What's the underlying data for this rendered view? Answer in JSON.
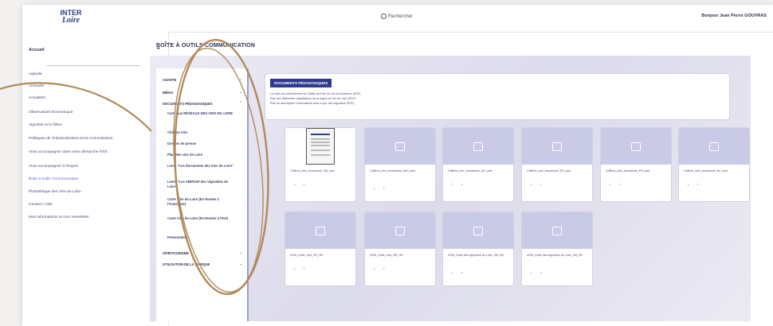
{
  "header": {
    "logo_line1": "INTER",
    "logo_line2": "Loire",
    "search_label": "Rechercher",
    "user_name": "Bonjour Jean Pierre GOUVRAS"
  },
  "sidebar": {
    "home_label": "Accueil",
    "items": [
      {
        "label": "Agenda",
        "active": false,
        "chevron": false
      },
      {
        "label": "Annuaire",
        "active": false,
        "chevron": false
      },
      {
        "label": "Actualités",
        "active": false,
        "chevron": false
      },
      {
        "label": "Observatoire Économique",
        "active": false,
        "chevron": true
      },
      {
        "label": "Vignoble et la filière",
        "active": false,
        "chevron": true
      },
      {
        "label": "Politiques de l'Interprofession et les Commissions",
        "active": false,
        "chevron": true
      },
      {
        "label": "Vous accompagner dans votre démarche RSE",
        "active": false,
        "chevron": true
      },
      {
        "label": "Vous accompagner à l'Export",
        "active": false,
        "chevron": true
      },
      {
        "label": "Boîte à outils Communication",
        "active": true,
        "chevron": false
      },
      {
        "label": "Photothèque des Vins de Loire",
        "active": false,
        "chevron": false
      },
      {
        "label": "Contact / Aide",
        "active": false,
        "chevron": false
      },
      {
        "label": "Mes informations et mon newsletter",
        "active": false,
        "chevron": false
      }
    ]
  },
  "main": {
    "title": "BOÎTE À OUTILS COMMUNICATION"
  },
  "tree": {
    "items": [
      {
        "label": "CHARTE",
        "chevron": "v"
      },
      {
        "label": "MÉDIA",
        "chevron": "v"
      },
      {
        "label": "DOCUMENTS PÉDAGOGIQUES",
        "chevron": "^"
      }
    ],
    "subitems": [
      "Carte aux RÉSEAUX DES VINS DE LOIRE",
      "Chiffres clés",
      "Dossier de presse",
      "Plan des vins de Loire",
      "Livret \"Les documents des Vins de Loire\"",
      "Livret \"Les SMPDSP des Vignobles de Loire\"",
      "Carte Vins de Loire (En Routes à l'Ouest/Est)",
      "Carte Vins de Loire (En Routes à l'Est)",
      "Présentations"
    ],
    "bottom_items": [
      {
        "label": "SPIRITOURISME",
        "chevron": "v"
      },
      {
        "label": "UTILISATION DE LA MARQUE",
        "chevron": "v"
      }
    ]
  },
  "info_box": {
    "title": "DOCUMENTS PÉDAGOGIQUES",
    "lines": [
      "La carte pré-sélectionnée au Chiffre de Plan de Vin de Bordeaux (PDF).",
      "Plan des différentes appellations de la région de Val de Loire (PDF).",
      "Plan de description / informations mise à jour des vignobles (PDF)."
    ]
  },
  "cards": [
    {
      "name": "Chiffres_clés_vinsdeloire_GB_web",
      "icons": "⇣ ⌕",
      "doc": true
    },
    {
      "name": "Chiffres_clés_vinsdeloire_web_web",
      "icons": "⇣ ⌕",
      "doc": false
    },
    {
      "name": "Chiffres_clés_vinsdeloire_DE_web",
      "icons": "⇣ ⌕",
      "doc": false
    },
    {
      "name": "Chiffres_clés_vinsdeloire_ES_web",
      "icons": "⇣ ⌕",
      "doc": false
    },
    {
      "name": "Chiffres_clés_vinsdeloire_FR_web",
      "icons": "⇣ ⌕",
      "doc": false
    },
    {
      "name": "Chiffres_clés_vinsdeloire_NL_web",
      "icons": "⇣ ⌕",
      "doc": false
    },
    {
      "name": "2018_Carte_vins_FR_HD",
      "icons": "⇣ ⌕",
      "doc": false
    },
    {
      "name": "2018_Carte_vins_GB_HD",
      "icons": "⇣ ⌕",
      "doc": false
    },
    {
      "name": "2018_Carte des vignobles de Loire_GB_HD",
      "icons": "⇣ ⌕",
      "doc": false
    },
    {
      "name": "2018_Carte des vignobles de Loire_GB_HD",
      "icons": "⇣ ⌕",
      "doc": false
    }
  ],
  "colors": {
    "accent": "#2f3a8f",
    "active_link": "#5b5fd6",
    "annotation": "#b08a5a"
  }
}
